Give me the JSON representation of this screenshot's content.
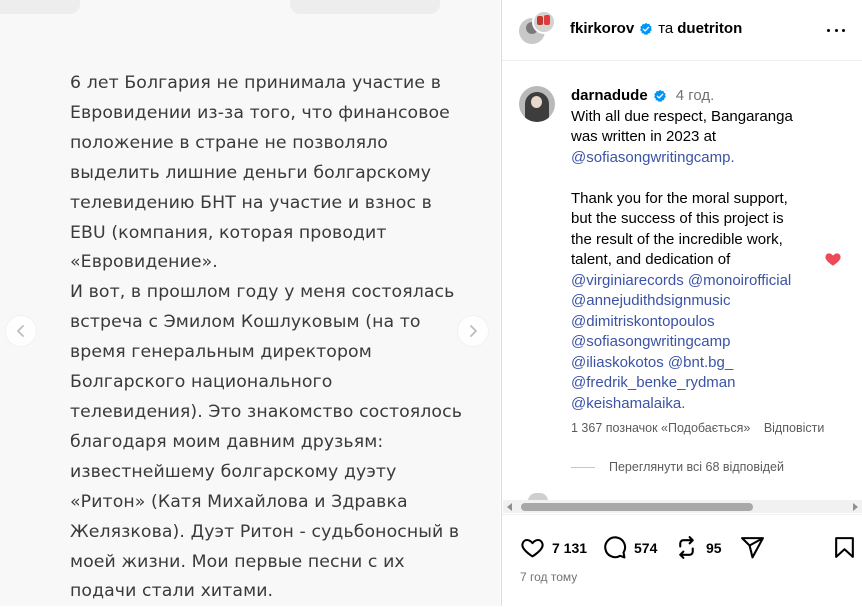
{
  "media": {
    "lines": [
      "6 лет Болгария не принимала участие в",
      "Евровидении из-за того, что финансовое",
      "положение в стране не позволяло",
      "выделить лишние деньги болгарскому",
      "телевидению БНТ на участие и взнос в",
      "EBU (компания, которая проводит",
      "«Евровидение».",
      "И вот, в прошлом году у меня состоялась",
      "встреча с Эмилом Кошлуковым (на то",
      "время генеральным директором",
      "Болгарского национального",
      "телевидения). Это знакомство состоялось",
      "благодаря моим давним друзьям:",
      "известнейшему болгарскому дуэту",
      "«Ритон» (Катя Михайлова и Здравка",
      "Желязкова). Дуэт Ритон - судьбоносный в",
      "моей жизни. Мои первые песни с их",
      "подачи стали хитами."
    ]
  },
  "header": {
    "author": "fkirkorov",
    "conjunction": "та",
    "coauthor": "duetriton"
  },
  "comment": {
    "username": "darnadude",
    "time": "4 год.",
    "lines": [
      {
        "text": "With all due respect, Bangaranga",
        "type": "text"
      },
      {
        "text": "was written in 2023 at",
        "type": "text"
      },
      {
        "text": "@sofiasongwritingcamp.",
        "type": "mention"
      },
      {
        "text": "",
        "type": "blank"
      },
      {
        "text": "Thank you for the moral support,",
        "type": "text"
      },
      {
        "text": "but the success of this project is",
        "type": "text"
      },
      {
        "text": "the result of the incredible work,",
        "type": "text"
      },
      {
        "text": "talent, and dedication of",
        "type": "text"
      },
      {
        "text": "@virginiarecords @monoirofficial",
        "type": "mention"
      },
      {
        "text": "@annejudithdsignmusic",
        "type": "mention"
      },
      {
        "text": "@dimitriskontopoulos",
        "type": "mention"
      },
      {
        "text": "@sofiasongwritingcamp",
        "type": "mention"
      },
      {
        "text": "@iliaskokotos @bnt.bg_",
        "type": "mention"
      },
      {
        "text": "@fredrik_benke_rydman",
        "type": "mention"
      },
      {
        "text": "@keishamalaika.",
        "type": "mention"
      }
    ],
    "likes_text": "1 367 позначок «Подобається»",
    "reply_label": "Відповісти",
    "view_replies": "Переглянути всі 68 відповідей"
  },
  "actions": {
    "likes": "7 131",
    "comments": "574",
    "reposts": "95"
  },
  "post_time": "7 год тому",
  "colors": {
    "mention": "#3b53a6",
    "heart": "#ed4956",
    "verified": "#0095f6"
  }
}
